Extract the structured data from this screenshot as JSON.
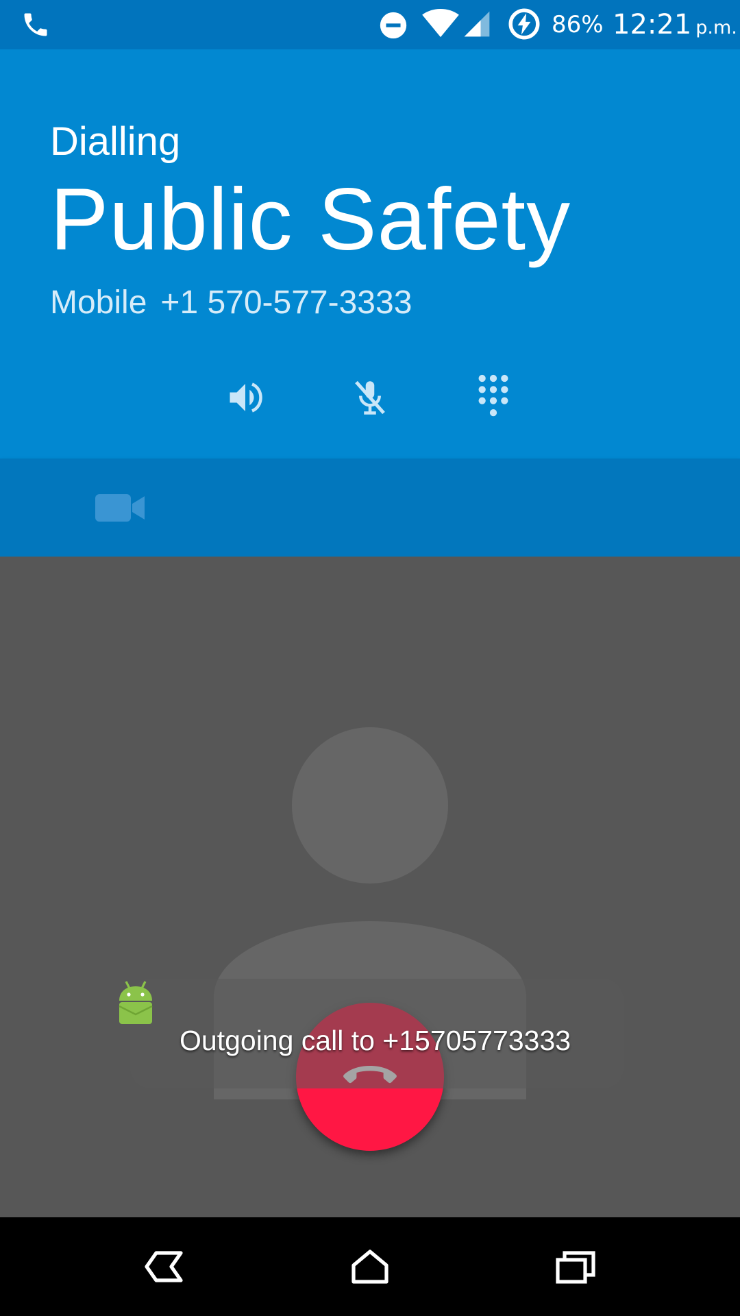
{
  "status_bar": {
    "battery_percent": "86%",
    "time": "12:21",
    "time_suffix": "p.m.",
    "icons": [
      "phone-call-icon",
      "do-not-disturb-icon",
      "wifi-icon",
      "cell-signal-icon",
      "battery-charging-icon"
    ]
  },
  "call": {
    "state": "Dialling",
    "contact_name": "Public Safety",
    "number_label": "Mobile",
    "number": "+1 570-577-3333",
    "controls": [
      "speaker-icon",
      "mute-icon",
      "dialpad-icon"
    ],
    "secondary_controls": [
      "video-call-icon"
    ]
  },
  "toast": {
    "text": "Outgoing call to +15705773333",
    "app_icon": "android-icon"
  },
  "nav_bar": {
    "buttons": [
      "back-icon",
      "home-icon",
      "recents-icon"
    ]
  },
  "colors": {
    "status_bar": "#0174bd",
    "header": "#0288d1",
    "secondary_bar": "#0277bd",
    "background": "#575757",
    "end_call": "#ff1744"
  }
}
